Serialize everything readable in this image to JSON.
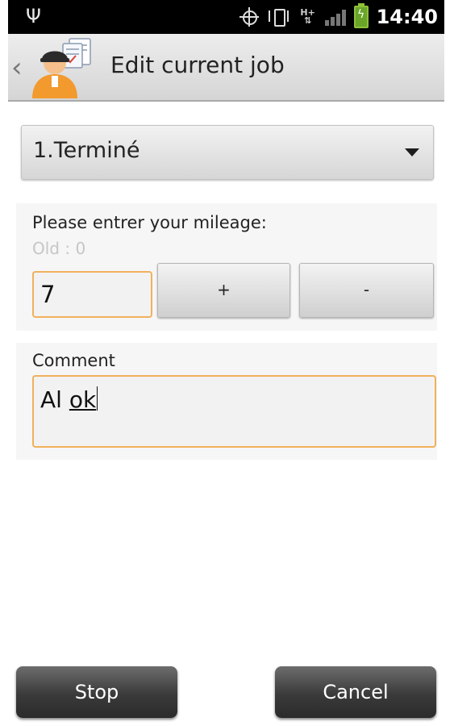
{
  "status_bar": {
    "time": "14:40",
    "icons": [
      "usb-icon",
      "gps-icon",
      "vibrate-icon",
      "hspa-icon",
      "signal-icon",
      "battery-charging-icon"
    ]
  },
  "action_bar": {
    "title": "Edit current job",
    "back_icon": "chevron-left-icon",
    "app_icon": "courier-worker-icon"
  },
  "status_select": {
    "value": "1.Terminé"
  },
  "mileage": {
    "label": "Please entrer your mileage:",
    "old_label": "Old : 0",
    "value": "7",
    "plus_label": "+",
    "minus_label": "-"
  },
  "comment": {
    "label": "Comment",
    "value_plain": "Al ",
    "value_underlined": "ok"
  },
  "footer": {
    "stop_label": "Stop",
    "cancel_label": "Cancel"
  },
  "colors": {
    "accent_focus": "#f2b05c",
    "status_bar": "#000000",
    "battery": "#8ec03a"
  }
}
